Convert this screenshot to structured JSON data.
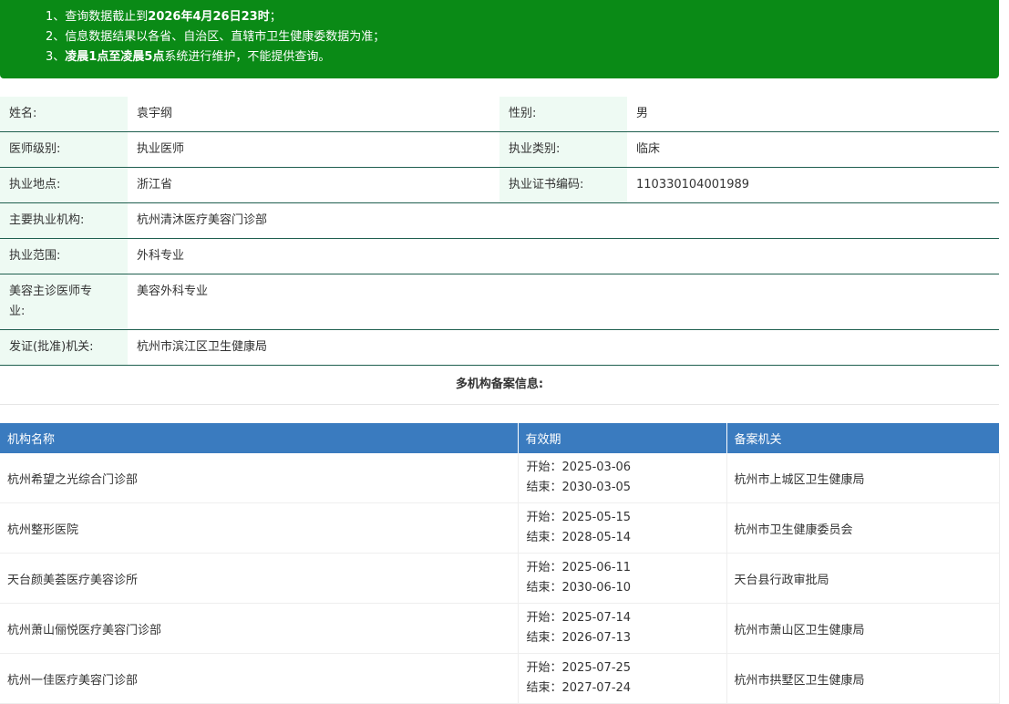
{
  "notice": {
    "line1_prefix": "1、查询数据截止到",
    "line1_bold": "2026年4月26日23时",
    "line1_suffix": "；",
    "line2": "2、信息数据结果以各省、自治区、直辖市卫生健康委数据为准；",
    "line3_prefix": "3、",
    "line3_bold": "凌晨1点至凌晨5点",
    "line3_suffix": "系统进行维护，不能提供查询。"
  },
  "info": {
    "name_label": "姓名:",
    "name_value": "袁宇纲",
    "gender_label": "性别:",
    "gender_value": "男",
    "level_label": "医师级别:",
    "level_value": "执业医师",
    "category_label": "执业类别:",
    "category_value": "临床",
    "location_label": "执业地点:",
    "location_value": "浙江省",
    "cert_label": "执业证书编码:",
    "cert_value": "110330104001989",
    "institution_label": "主要执业机构:",
    "institution_value": "杭州清沐医疗美容门诊部",
    "scope_label": "执业范围:",
    "scope_value": "外科专业",
    "cosmetic_label_1": "美容主诊医师专",
    "cosmetic_label_2": "业:",
    "cosmetic_value": "美容外科专业",
    "issuer_label": "发证(批准)机关:",
    "issuer_value": "杭州市滨江区卫生健康局"
  },
  "multi_title": "多机构备案信息:",
  "table": {
    "headers": [
      "机构名称",
      "有效期",
      "备案机关"
    ],
    "rows": [
      {
        "name": "杭州希望之光综合门诊部",
        "start": "开始：2025-03-06",
        "end": "结束：2030-03-05",
        "authority": "杭州市上城区卫生健康局"
      },
      {
        "name": "杭州整形医院",
        "start": "开始：2025-05-15",
        "end": "结束：2028-05-14",
        "authority": "杭州市卫生健康委员会"
      },
      {
        "name": "天台颜美荟医疗美容诊所",
        "start": "开始：2025-06-11",
        "end": "结束：2030-06-10",
        "authority": "天台县行政审批局"
      },
      {
        "name": "杭州萧山俪悦医疗美容门诊部",
        "start": "开始：2025-07-14",
        "end": "结束：2026-07-13",
        "authority": "杭州市萧山区卫生健康局"
      },
      {
        "name": "杭州一佳医疗美容门诊部",
        "start": "开始：2025-07-25",
        "end": "结束：2027-07-24",
        "authority": "杭州市拱墅区卫生健康局"
      }
    ]
  }
}
